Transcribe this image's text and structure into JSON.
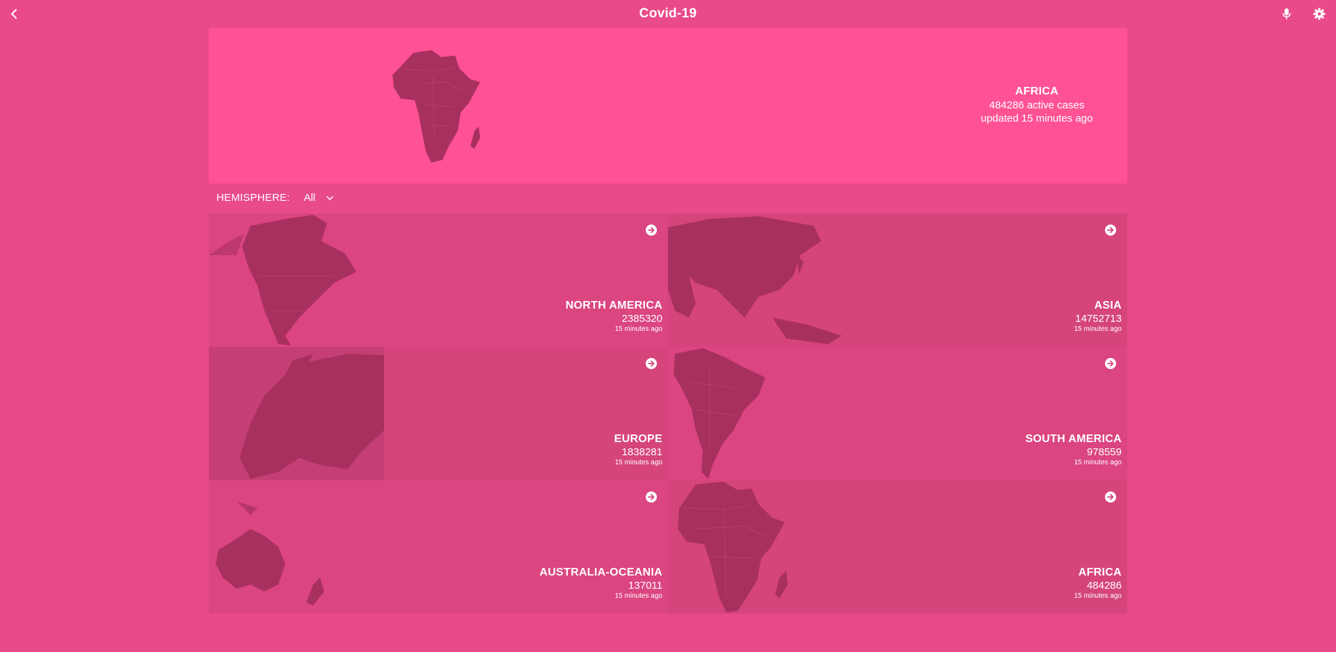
{
  "header": {
    "title": "Covid-19",
    "back_icon": "chevron-left-icon",
    "mic_icon": "microphone-icon",
    "settings_icon": "gear-icon"
  },
  "hero": {
    "name": "AFRICA",
    "active_cases": "484286 active cases",
    "updated": "updated 15 minutes ago"
  },
  "filter": {
    "label": "HEMISPHERE:",
    "selected": "All"
  },
  "continents": [
    {
      "name": "NORTH AMERICA",
      "count": "2385320",
      "updated": "15 minutes ago"
    },
    {
      "name": "ASIA",
      "count": "14752713",
      "updated": "15 minutes ago"
    },
    {
      "name": "EUROPE",
      "count": "1838281",
      "updated": "15 minutes ago"
    },
    {
      "name": "SOUTH AMERICA",
      "count": "978559",
      "updated": "15 minutes ago"
    },
    {
      "name": "AUSTRALIA-OCEANIA",
      "count": "137011",
      "updated": "15 minutes ago"
    },
    {
      "name": "AFRICA",
      "count": "484286",
      "updated": "15 minutes ago"
    }
  ],
  "colors": {
    "background": "#e94a8a",
    "hero": "#ff5294",
    "card": "#db4580",
    "map": "#a8305f",
    "text": "#ffffff"
  }
}
